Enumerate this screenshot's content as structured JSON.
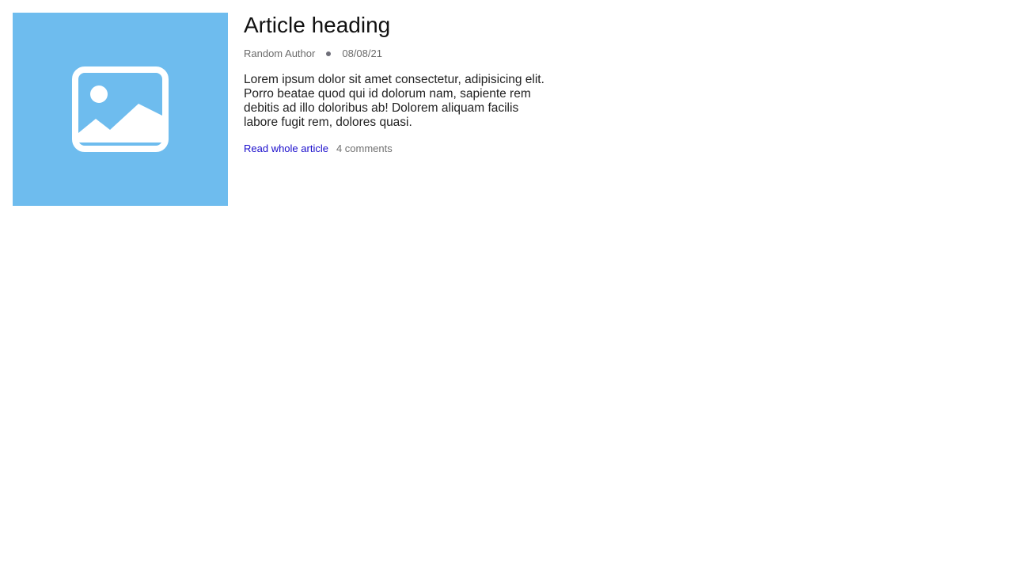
{
  "article": {
    "title": "Article heading",
    "author": "Random Author",
    "date": "08/08/21",
    "excerpt": "Lorem ipsum dolor sit amet consectetur, adipisicing elit. Porro beatae quod qui id dolorum nam, sapiente rem debitis ad illo doloribus ab! Dolorem aliquam facilis labore fugit rem, dolores quasi.",
    "read_more_label": "Read whole article",
    "comments_label": "4 comments",
    "thumbnail_icon": "image-placeholder-icon"
  },
  "colors": {
    "thumbnail_bg": "#6ebcee",
    "link": "#1a0dcc",
    "meta_text": "#6b6b6b"
  }
}
